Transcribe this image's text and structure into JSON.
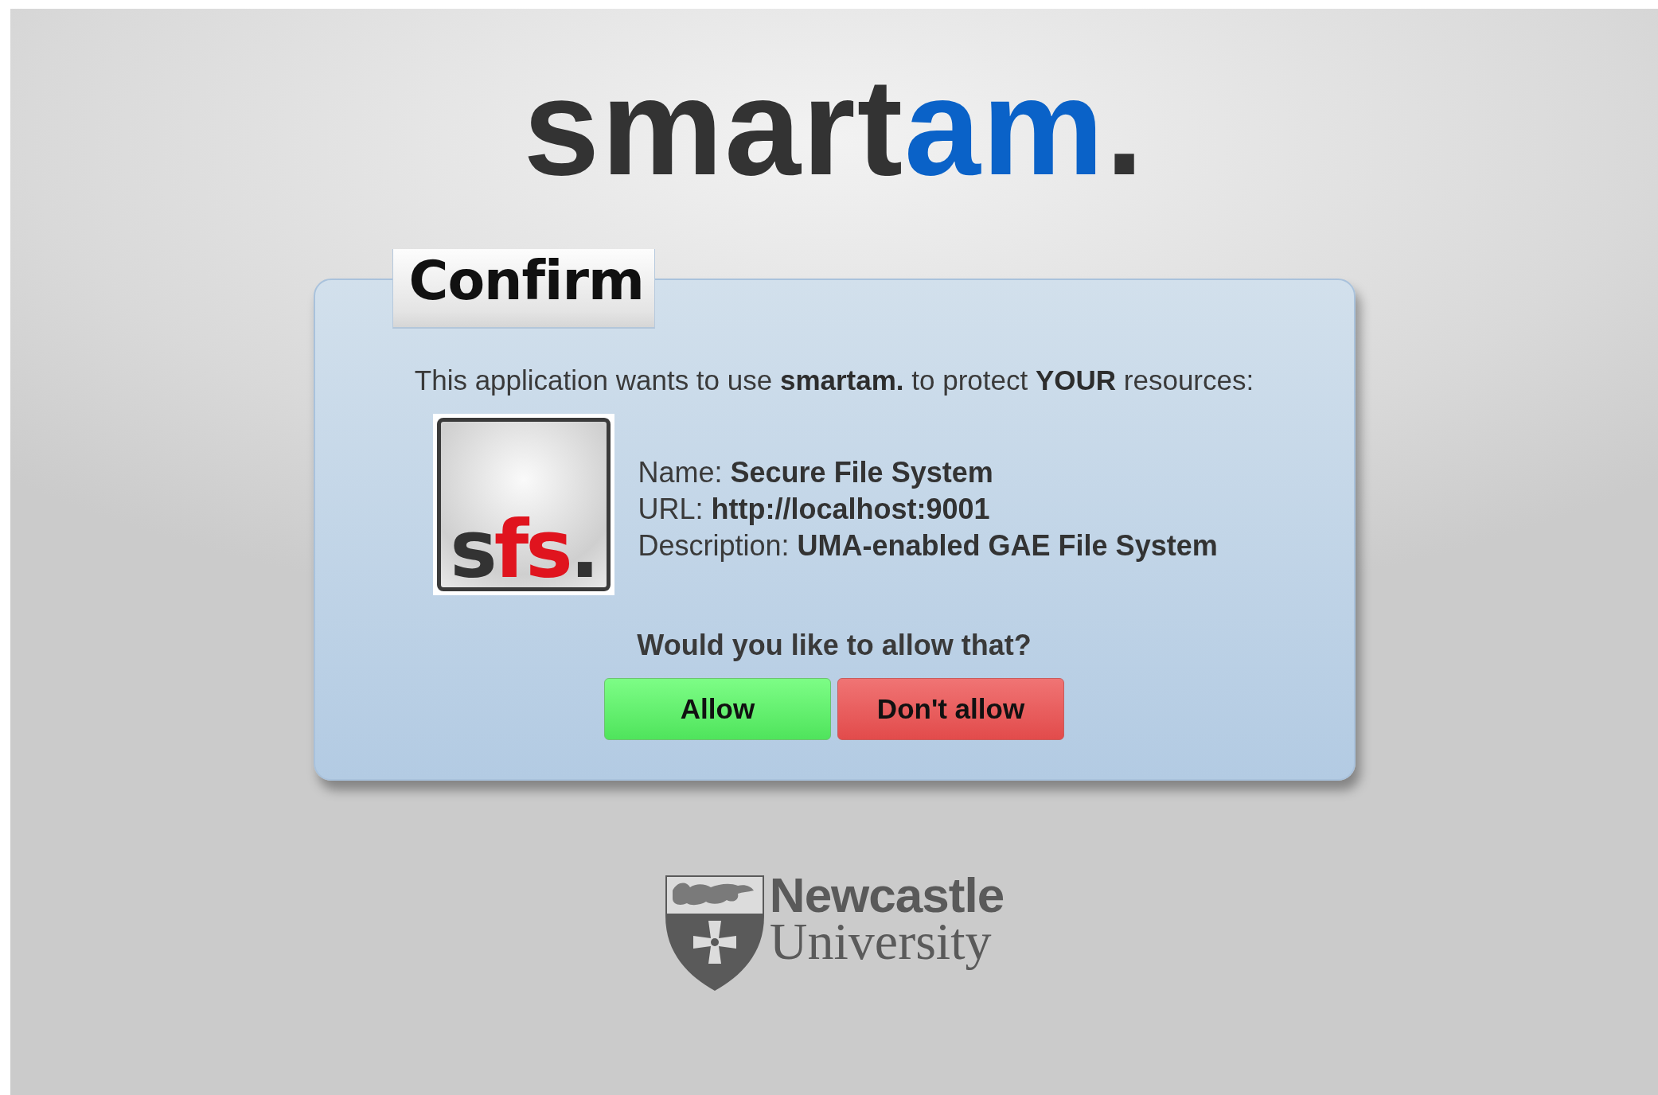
{
  "logo": {
    "parts": [
      {
        "text": "smart",
        "color": "#333333"
      },
      {
        "text": "am",
        "color": "#0a62c8"
      },
      {
        "text": ".",
        "color": "#333333"
      }
    ]
  },
  "dialog": {
    "title": "Confirm",
    "intro": "This application wants to use **smartam.** to protect **YOUR** resources:",
    "app": {
      "icon_parts": [
        {
          "text": "s",
          "color": "#333333"
        },
        {
          "text": "fs",
          "color": "#e0141e"
        },
        {
          "text": ".",
          "color": "#333333"
        }
      ],
      "details": [
        "Name: **Secure File System**",
        "URL: **http://localhost:9001**",
        "Description: **UMA-enabled GAE File System**"
      ]
    },
    "question": "Would you like to allow that?",
    "buttons": [
      {
        "label": "Allow",
        "kind": "allow"
      },
      {
        "label": "Don't allow",
        "kind": "deny"
      }
    ]
  },
  "footer": {
    "lines": [
      "Newcastle",
      "University"
    ]
  }
}
